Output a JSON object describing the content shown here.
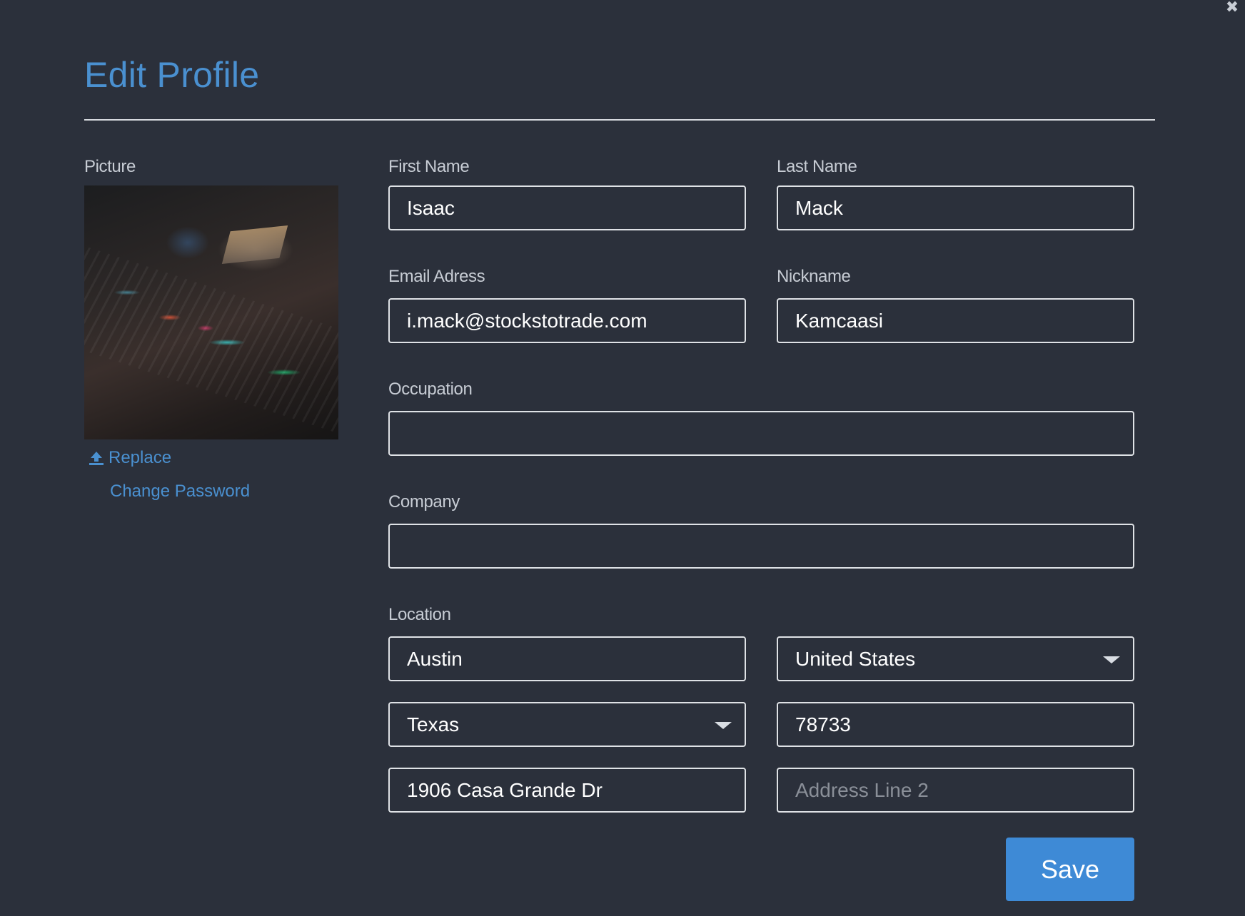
{
  "dialog": {
    "title": "Edit Profile",
    "close_glyph": "✖"
  },
  "picture": {
    "label": "Picture",
    "replace_label": "Replace",
    "change_password_label": "Change Password"
  },
  "fields": {
    "first_name": {
      "label": "First Name",
      "value": "Isaac"
    },
    "last_name": {
      "label": "Last Name",
      "value": "Mack"
    },
    "email": {
      "label": "Email Adress",
      "value": "i.mack@stockstotrade.com"
    },
    "nickname": {
      "label": "Nickname",
      "value": "Kamcaasi"
    },
    "occupation": {
      "label": "Occupation",
      "value": ""
    },
    "company": {
      "label": "Company",
      "value": ""
    }
  },
  "location": {
    "label": "Location",
    "city": "Austin",
    "country": "United States",
    "state": "Texas",
    "zip": "78733",
    "address_line_1": "1906 Casa Grande Dr",
    "address_line_2_placeholder": "Address Line 2"
  },
  "actions": {
    "save_label": "Save"
  },
  "colors": {
    "background": "#2b303b",
    "accent": "#4a90d0",
    "button": "#3e8ad6"
  }
}
